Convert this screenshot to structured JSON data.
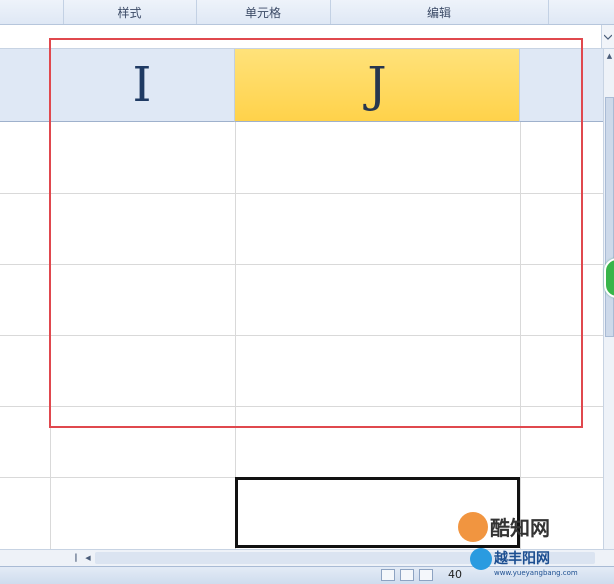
{
  "ribbon": {
    "groups": [
      {
        "label": ""
      },
      {
        "label": "样式"
      },
      {
        "label": "单元格"
      },
      {
        "label": "编辑"
      },
      {
        "label": ""
      }
    ]
  },
  "columns": {
    "col_i": "I",
    "col_j": "J"
  },
  "status": {
    "zoom": "40"
  },
  "watermark": {
    "brand1": "酷知网",
    "brand2": "越丰阳网",
    "url": "www.yueyangbang.com"
  },
  "colors": {
    "header_bg": "#dfe8f5",
    "selected_header": "#ffd24a",
    "highlight_box": "#e0484e",
    "gridline": "#d9d9d9"
  }
}
